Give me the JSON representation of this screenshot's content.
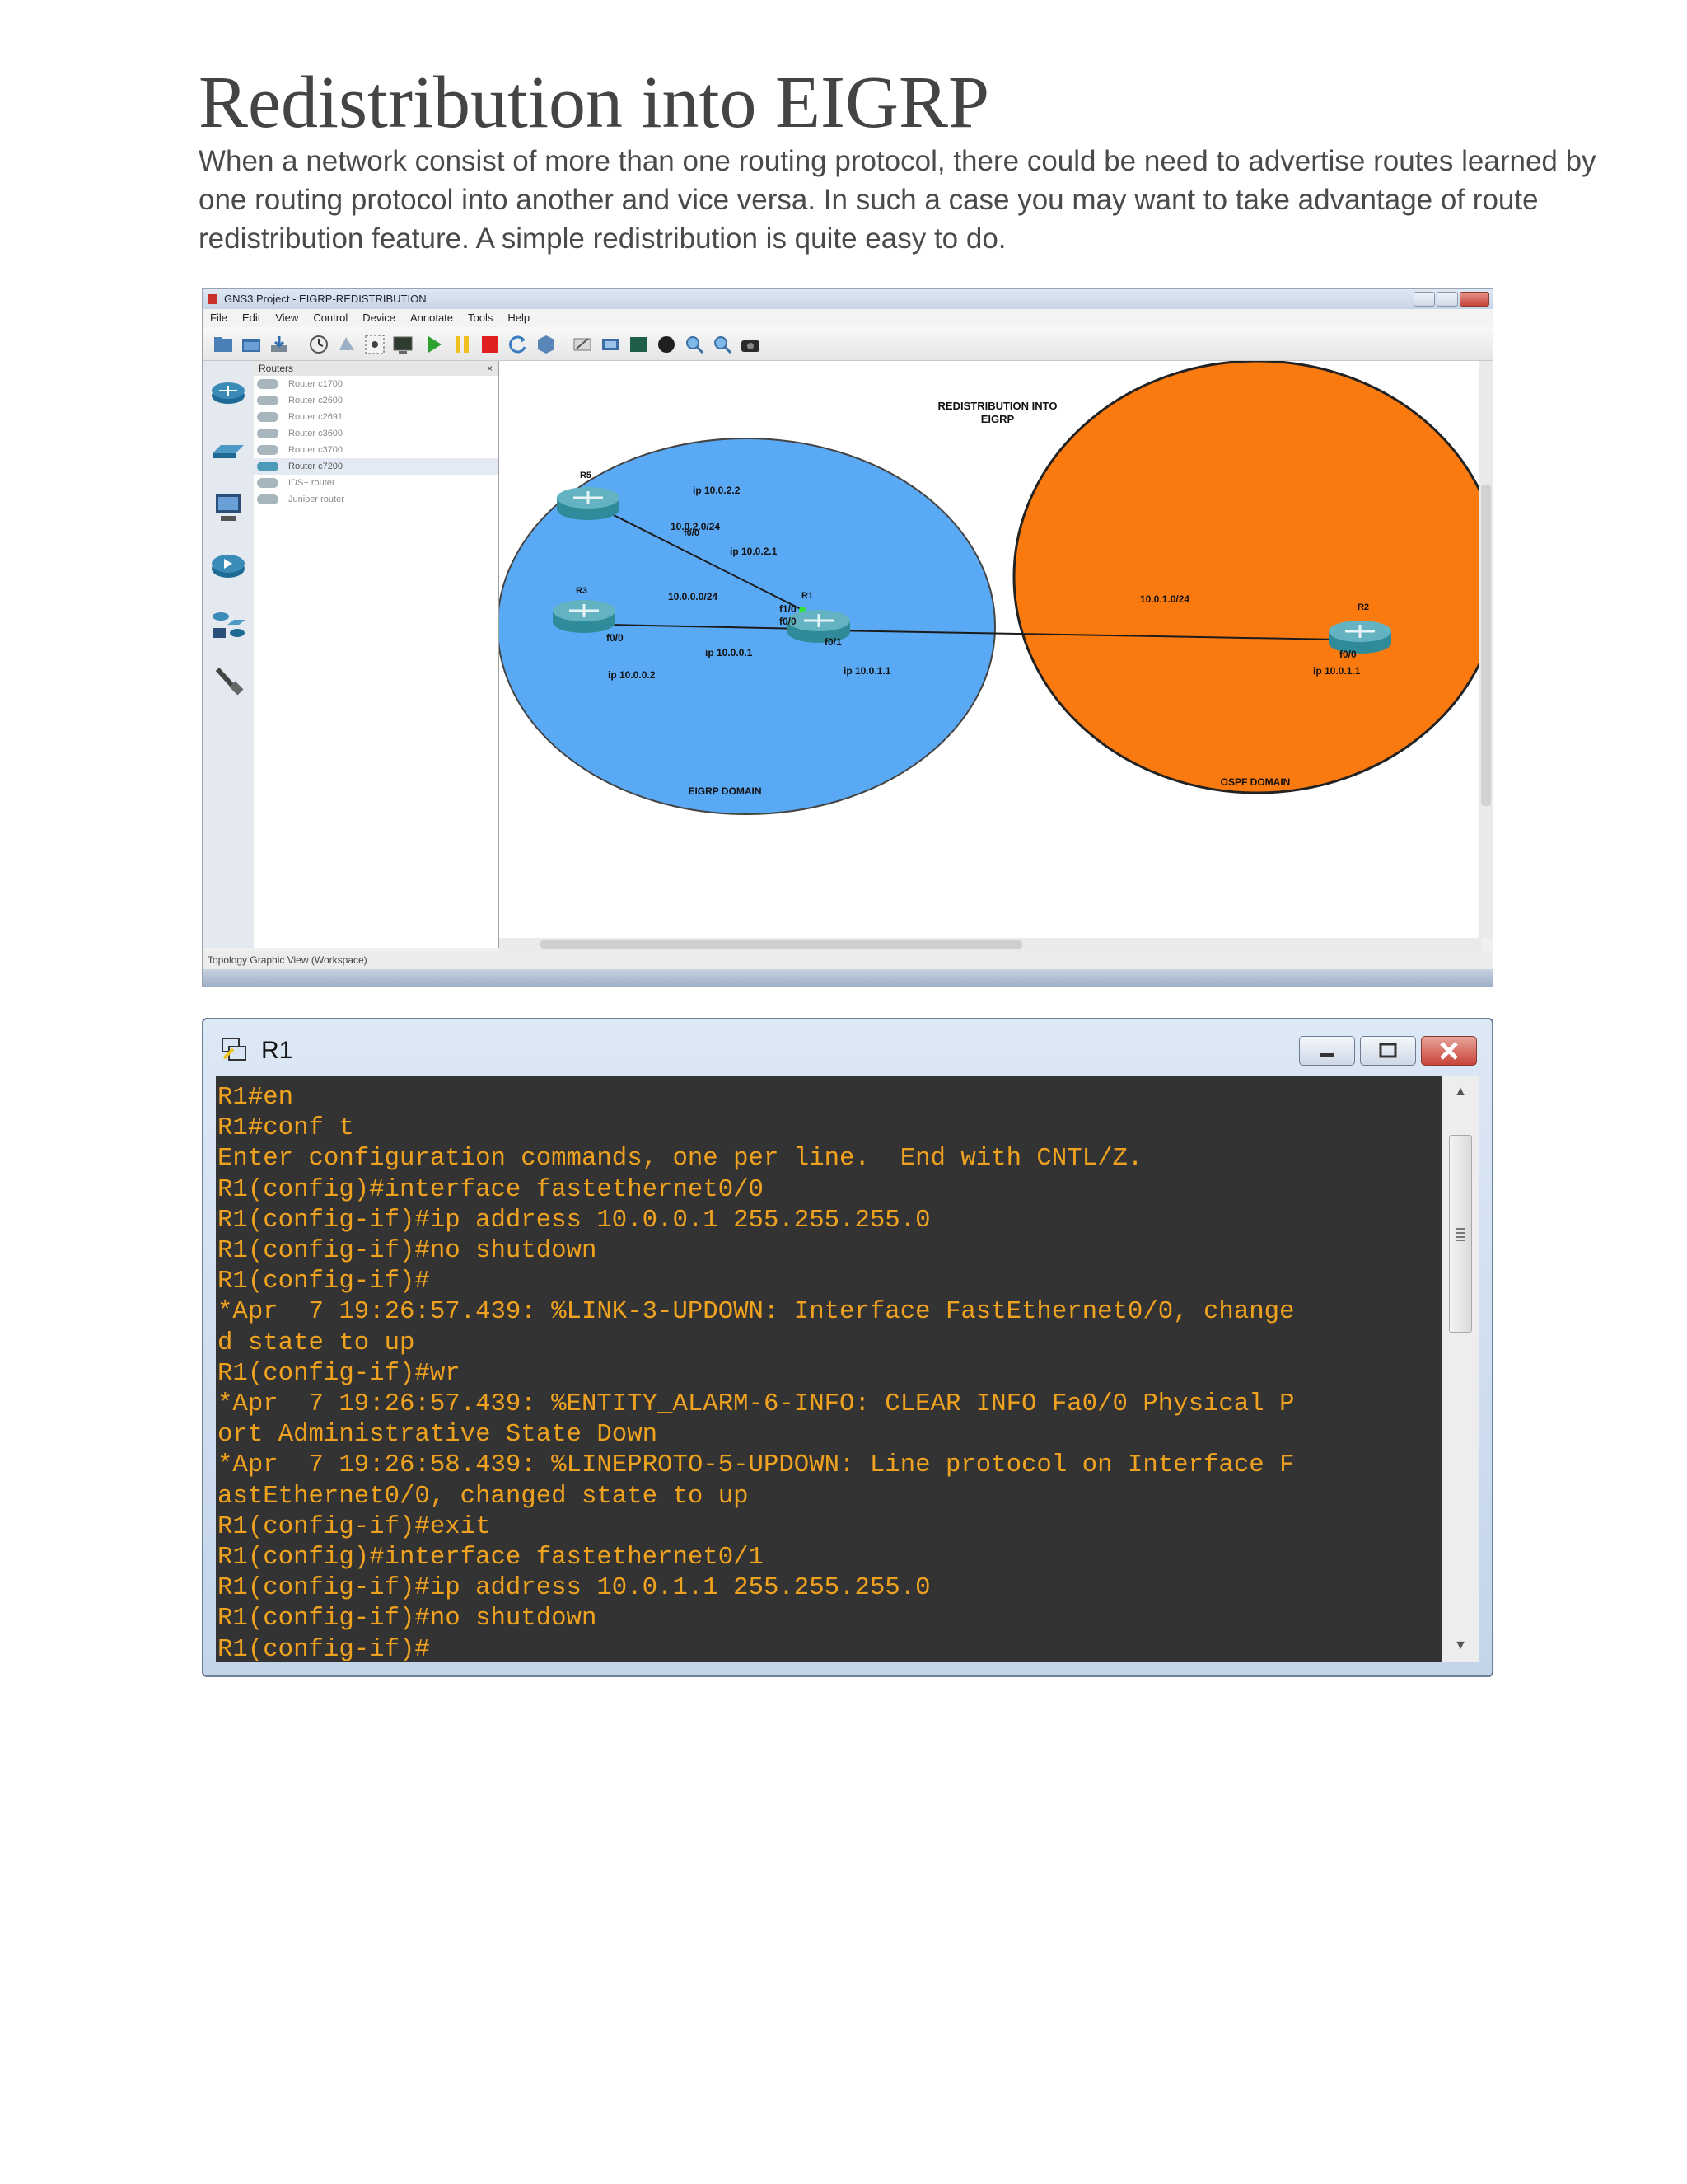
{
  "document": {
    "title": "Redistribution into EIGRP",
    "intro": "When a network consist of more than one routing protocol, there could be need to advertise routes learned by one routing protocol into another and vice versa. In such a case you may want to take advantage of route redistribution feature. A simple redistribution is quite easy to do."
  },
  "gns3": {
    "window_title": "GNS3 Project - EIGRP-REDISTRIBUTION",
    "menu": [
      "File",
      "Edit",
      "View",
      "Control",
      "Device",
      "Annotate",
      "Tools",
      "Help"
    ],
    "routers_panel_title": "Routers",
    "routers_panel_buttons": "×",
    "routers": [
      "Router c1700",
      "Router c2600",
      "Router c2691",
      "Router c3600",
      "Router c3700",
      "Router c7200",
      "IDS+ router",
      "Juniper router"
    ],
    "selected_router": "Router c7200",
    "status_text": "Topology Graphic View (Workspace)",
    "topology": {
      "heading_line1": "REDISTRIBUTION INTO",
      "heading_line2": "EIGRP",
      "eigrp_domain_label": "EIGRP DOMAIN",
      "ospf_domain_label": "OSPF DOMAIN",
      "eigrp_color": "#5aa9f5",
      "ospf_color": "#fb7a10",
      "routers": [
        {
          "name": "R5",
          "interface": "f0/0",
          "ip": "ip 10.0.2.2"
        },
        {
          "name": "R3",
          "interface": "f0/0",
          "ip": "ip 10.0.0.2"
        },
        {
          "name": "R1",
          "interfaces": [
            "f1/0",
            "f0/0",
            "f0/1"
          ]
        },
        {
          "name": "R2",
          "interface": "f0/0",
          "ip": "ip 10.0.1.1"
        }
      ],
      "links": [
        {
          "subnet": "10.0.2.0/24",
          "ip": "ip 10.0.2.1"
        },
        {
          "subnet": "10.0.0.0/24",
          "ip": "ip 10.0.0.1"
        },
        {
          "subnet": "10.0.1.0/24",
          "ip": "ip 10.0.1.1"
        }
      ]
    }
  },
  "terminal": {
    "window_title": "R1",
    "text_color": "#efa21f",
    "background_color": "#333333",
    "lines": [
      "R1#en",
      "R1#conf t",
      "Enter configuration commands, one per line.  End with CNTL/Z.",
      "R1(config)#interface fastethernet0/0",
      "R1(config-if)#ip address 10.0.0.1 255.255.255.0",
      "R1(config-if)#no shutdown",
      "R1(config-if)#",
      "*Apr  7 19:26:57.439: %LINK-3-UPDOWN: Interface FastEthernet0/0, change",
      "d state to up",
      "R1(config-if)#wr",
      "*Apr  7 19:26:57.439: %ENTITY_ALARM-6-INFO: CLEAR INFO Fa0/0 Physical P",
      "ort Administrative State Down",
      "*Apr  7 19:26:58.439: %LINEPROTO-5-UPDOWN: Line protocol on Interface F",
      "astEthernet0/0, changed state to up",
      "R1(config-if)#exit",
      "R1(config)#interface fastethernet0/1",
      "R1(config-if)#ip address 10.0.1.1 255.255.255.0",
      "R1(config-if)#no shutdown",
      "R1(config-if)#"
    ]
  }
}
